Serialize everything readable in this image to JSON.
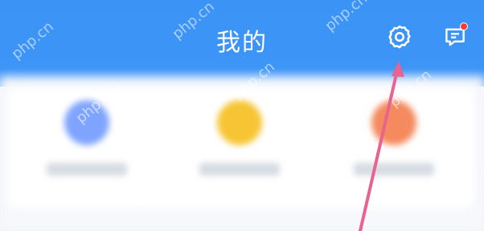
{
  "header": {
    "title": "我的",
    "settings_icon": "gear-icon",
    "messages_icon": "message-icon",
    "has_unread_badge": true
  },
  "shortcuts": [
    {
      "label": "",
      "icon_color": "#7fa4ff"
    },
    {
      "label": "",
      "icon_color": "#f7c533"
    },
    {
      "label": "",
      "icon_color": "#f48a5e"
    }
  ],
  "watermark": "php.cn",
  "colors": {
    "header_blue": "#3b93f6",
    "badge_red": "#ff3b30",
    "annotation_pink": "#e8638f"
  }
}
